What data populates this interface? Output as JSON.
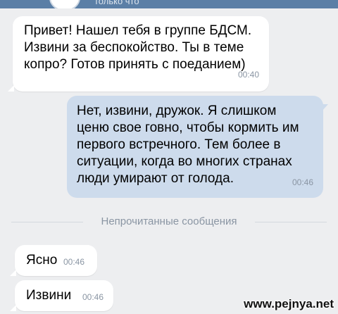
{
  "header": {
    "status_text": "только что"
  },
  "messages": [
    {
      "direction": "incoming",
      "text": "Привет! Нашел тебя в группе БДСМ.\nИзвини за беспокойство. Ты в теме\nкопро? Готов принять с поеданием)",
      "time": "00:40"
    },
    {
      "direction": "outgoing",
      "text": "Нет, извини, дружок. Я слишком\nценю свое говно, чтобы кормить им\nпервого встречного. Тем более в\nситуации, когда во многих странах\nлюди умирают от голода.",
      "time": "00:46"
    }
  ],
  "divider": {
    "label": "Непрочитанные сообщения"
  },
  "unread_messages": [
    {
      "direction": "incoming",
      "text": "Ясно",
      "time": "00:46"
    },
    {
      "direction": "incoming",
      "text": "Извини",
      "time": "00:46"
    }
  ],
  "watermark": "www.pejnya.net",
  "colors": {
    "background": "#edeef0",
    "incoming_bubble": "#ffffff",
    "outgoing_bubble": "#cddbec",
    "timestamp": "#8a95a3",
    "header": "#5b7fa6"
  }
}
